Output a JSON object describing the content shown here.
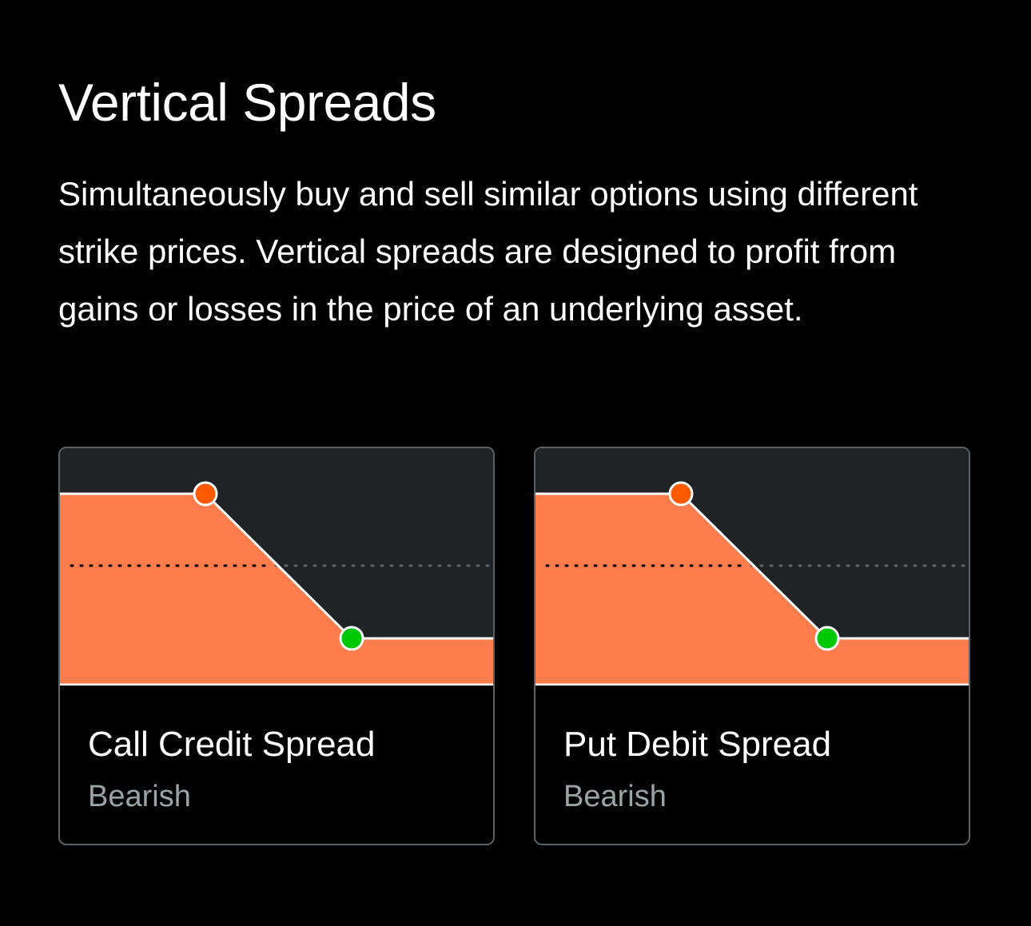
{
  "page": {
    "title": "Vertical Spreads",
    "description": "Simultaneously buy and sell similar options using different strike prices. Vertical spreads are designed to profit from gains or losses in the price of an underlying asset."
  },
  "colors": {
    "background": "#000000",
    "chart_background": "#1f2325",
    "payoff_fill": "#ff7c4c",
    "orange_point": "#ff5a00",
    "green_point": "#00c805",
    "card_border": "#5a6265",
    "sentiment_text": "#9aa3a6"
  },
  "cards": [
    {
      "name": "Call Credit Spread",
      "sentiment": "Bearish",
      "icons": [
        "short-strike-dot-icon",
        "long-strike-dot-icon"
      ]
    },
    {
      "name": "Put Debit Spread",
      "sentiment": "Bearish",
      "icons": [
        "short-strike-dot-icon",
        "long-strike-dot-icon"
      ]
    }
  ]
}
